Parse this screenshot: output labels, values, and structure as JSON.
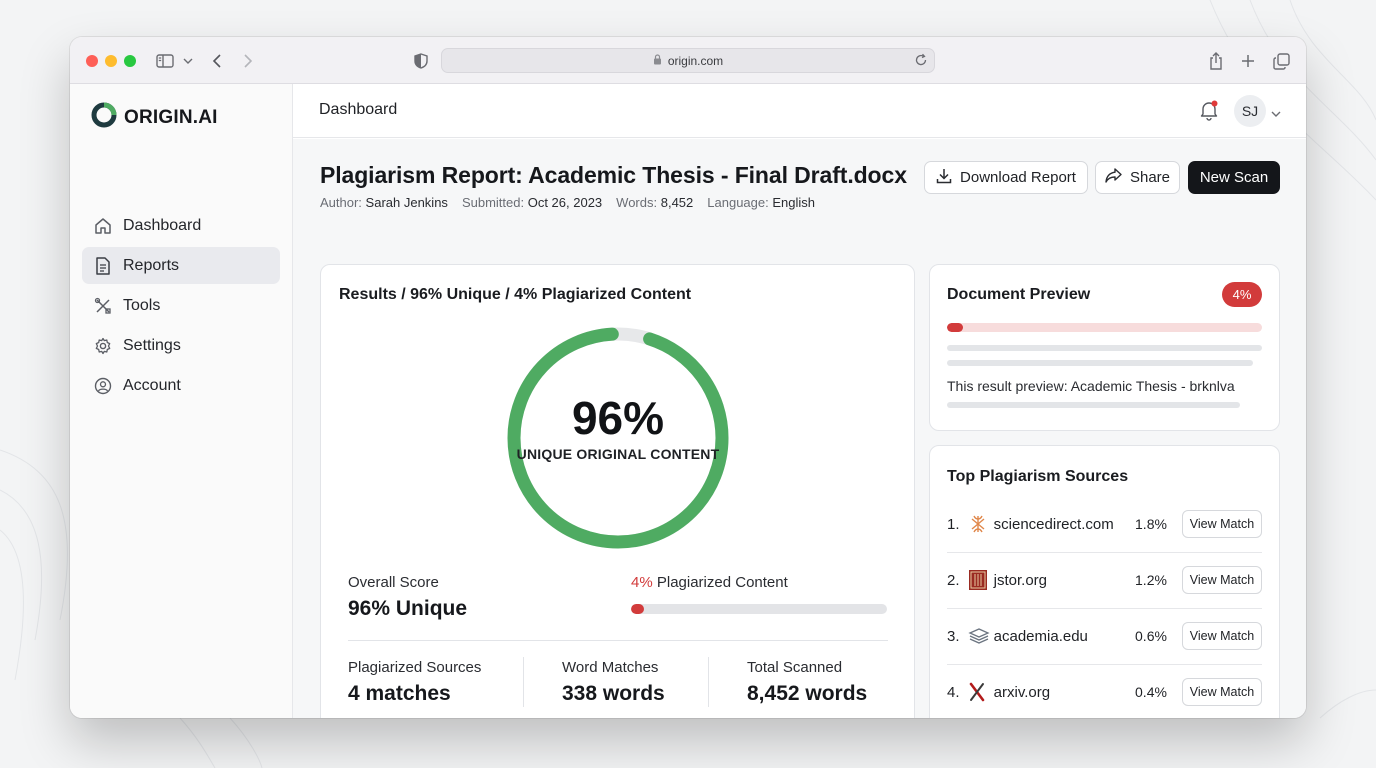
{
  "browser": {
    "url": "origin.com"
  },
  "app": {
    "name": "ORIGIN.AI"
  },
  "sidebar": {
    "items": [
      {
        "label": "Dashboard",
        "icon": "home-icon",
        "active": false
      },
      {
        "label": "Reports",
        "icon": "document-icon",
        "active": true
      },
      {
        "label": "Tools",
        "icon": "tools-icon",
        "active": false
      },
      {
        "label": "Settings",
        "icon": "gear-icon",
        "active": false
      },
      {
        "label": "Account",
        "icon": "user-circle-icon",
        "active": false
      }
    ]
  },
  "topbar": {
    "title": "Dashboard",
    "avatar_initials": "SJ",
    "notification_dot": true
  },
  "report": {
    "title": "Plagiarism Report: Academic Thesis - Final Draft.docx",
    "meta": {
      "author_label": "Author:",
      "author": "Sarah Jenkins",
      "submitted_label": "Submitted:",
      "submitted": "Oct 26, 2023",
      "words_label": "Words:",
      "words": "8,452",
      "language_label": "Language:",
      "language": "English"
    },
    "actions": {
      "download": "Download Report",
      "share": "Share",
      "new_scan": "New Scan"
    }
  },
  "results": {
    "title": "Results / 96% Unique / 4% Plagiarized Content",
    "donut": {
      "unique_percent": 96,
      "value": "96%",
      "label": "UNIQUE ORIGINAL CONTENT"
    },
    "overall_score_label": "Overall Score",
    "overall_score_value": "96% Unique",
    "plagiarized_pct": "4%",
    "plagiarized_label": "Plagiarized Content",
    "plagiarized_fraction": 0.04,
    "stats": [
      {
        "label": "Plagiarized Sources",
        "value": "4 matches"
      },
      {
        "label": "Word Matches",
        "value": "338 words"
      },
      {
        "label": "Total Scanned",
        "value": "8,452 words"
      }
    ]
  },
  "preview": {
    "title": "Document Preview",
    "badge": "4%",
    "fraction": 0.04,
    "text": "This result preview: Academic Thesis - brknlva"
  },
  "sources": {
    "title": "Top Plagiarism Sources",
    "button_label": "View Match",
    "items": [
      {
        "rank": "1.",
        "name": "sciencedirect.com",
        "percent": "1.8%",
        "icon": "sciencedirect-logo-icon"
      },
      {
        "rank": "2.",
        "name": "jstor.org",
        "percent": "1.2%",
        "icon": "jstor-logo-icon"
      },
      {
        "rank": "3.",
        "name": "academia.edu",
        "percent": "0.6%",
        "icon": "academia-logo-icon"
      },
      {
        "rank": "4.",
        "name": "arxiv.org",
        "percent": "0.4%",
        "icon": "arxiv-logo-icon"
      }
    ]
  },
  "colors": {
    "accent_green": "#4fab62",
    "alert_red": "#d23b3b",
    "primary_dark": "#14161a"
  }
}
